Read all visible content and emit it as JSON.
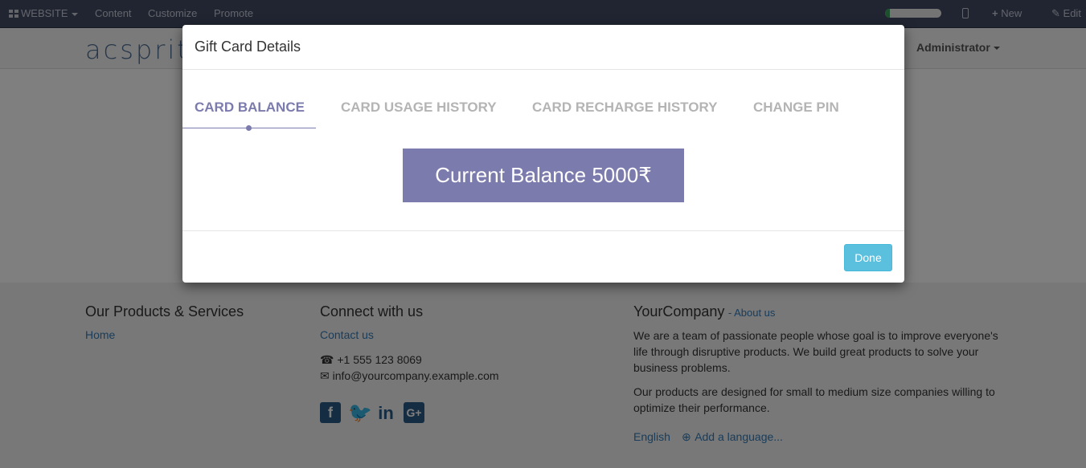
{
  "topbar": {
    "website_label": "WEBSITE",
    "content_label": "Content",
    "customize_label": "Customize",
    "promote_label": "Promote",
    "new_label": "New",
    "edit_label": "Edit"
  },
  "header": {
    "logo_text": "acsprit",
    "user_label": "Administrator"
  },
  "footer": {
    "products_title": "Our Products & Services",
    "home_link": "Home",
    "connect_title": "Connect with us",
    "contact_link": "Contact us",
    "phone": "+1 555 123 8069",
    "email": "info@yourcompany.example.com",
    "company_title": "YourCompany",
    "about_link": "- About us",
    "about_text_1": "We are a team of passionate people whose goal is to improve everyone's life through disruptive products. We build great products to solve your business problems.",
    "about_text_2": "Our products are designed for small to medium size companies willing to optimize their performance.",
    "language": "English",
    "add_language": "Add a language..."
  },
  "modal": {
    "title": "Gift Card Details",
    "tabs": [
      {
        "label": "CARD BALANCE",
        "active": true
      },
      {
        "label": "CARD USAGE HISTORY",
        "active": false
      },
      {
        "label": "CARD RECHARGE HISTORY",
        "active": false
      },
      {
        "label": "CHANGE PIN",
        "active": false
      }
    ],
    "balance_text": "Current Balance 5000₹",
    "done_label": "Done"
  },
  "colors": {
    "accent": "#7c7bad",
    "done_button": "#5bc0de",
    "topbar": "#414b63",
    "link": "#337ab7"
  }
}
